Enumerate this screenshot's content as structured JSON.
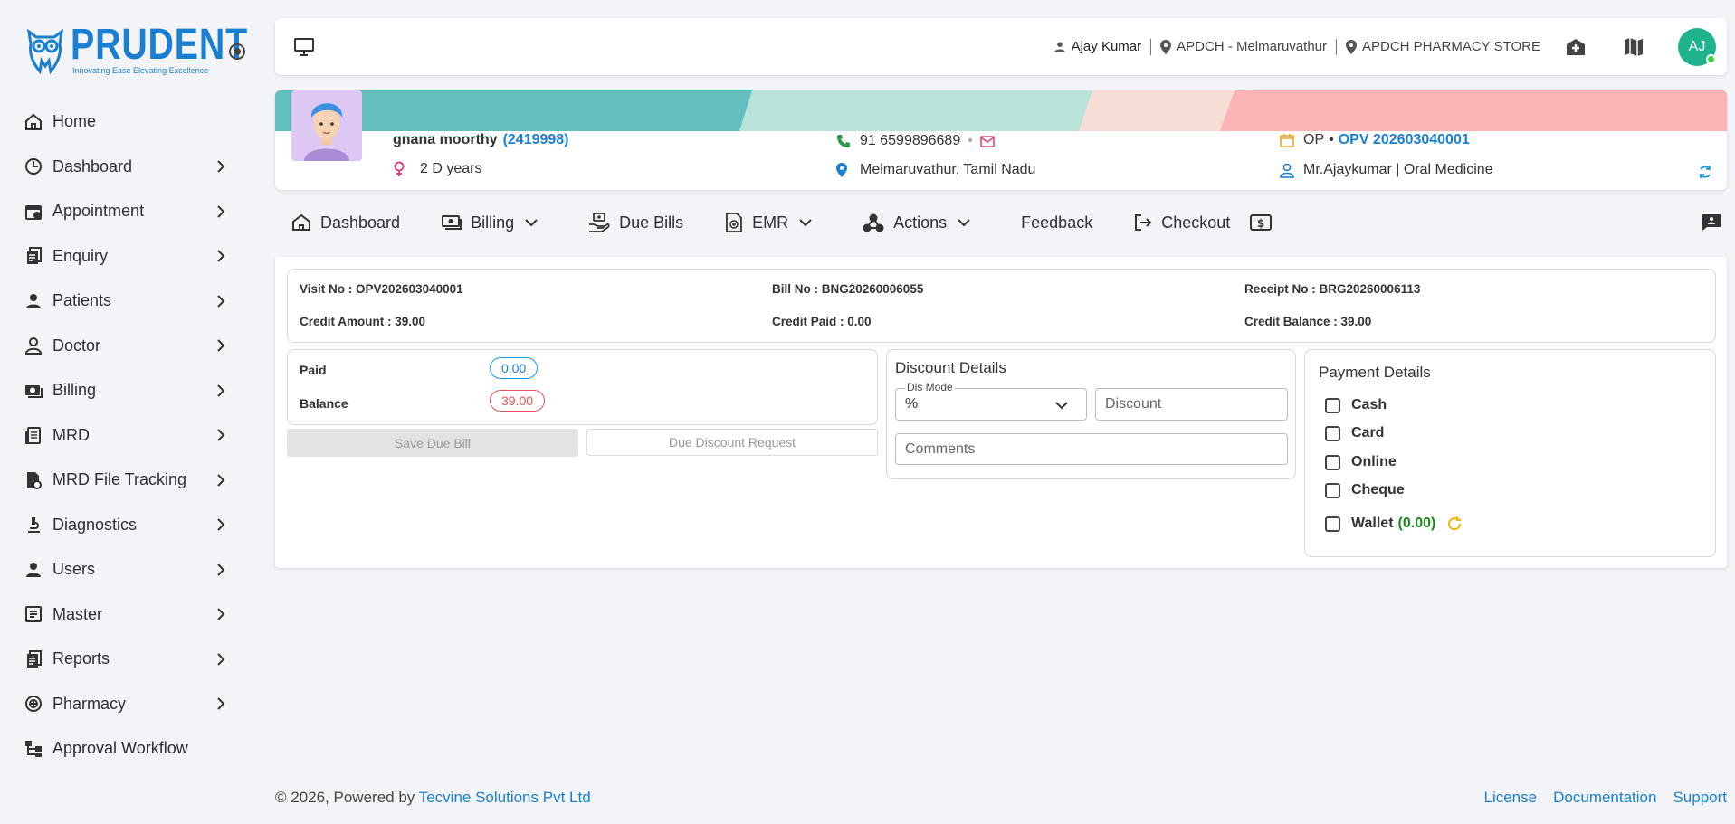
{
  "brand": {
    "name": "PRUDENT",
    "tagline": "Innovating Ease Elevating Excellence"
  },
  "sidebar": {
    "items": [
      {
        "label": "Home",
        "icon": "home-icon"
      },
      {
        "label": "Dashboard",
        "icon": "clock-icon"
      },
      {
        "label": "Appointment",
        "icon": "calendar-icon"
      },
      {
        "label": "Enquiry",
        "icon": "document-icon"
      },
      {
        "label": "Patients",
        "icon": "person-icon"
      },
      {
        "label": "Doctor",
        "icon": "doctor-icon"
      },
      {
        "label": "Billing",
        "icon": "money-icon"
      },
      {
        "label": "MRD",
        "icon": "records-icon"
      },
      {
        "label": "MRD File Tracking",
        "icon": "file-tracking-icon"
      },
      {
        "label": "Diagnostics",
        "icon": "microscope-icon"
      },
      {
        "label": "Users",
        "icon": "person-icon"
      },
      {
        "label": "Master",
        "icon": "list-icon"
      },
      {
        "label": "Reports",
        "icon": "report-icon"
      },
      {
        "label": "Pharmacy",
        "icon": "pharmacy-icon"
      },
      {
        "label": "Approval Workflow",
        "icon": "workflow-icon"
      }
    ]
  },
  "header": {
    "user": "Ajay Kumar",
    "location": "APDCH - Melmaruvathur",
    "store": "APDCH PHARMACY STORE",
    "avatar_initials": "AJ"
  },
  "patient": {
    "name": "gnana moorthy",
    "id": "(2419998)",
    "age": "2 D years",
    "phone": "91 6599896689",
    "address": "Melmaruvathur, Tamil Nadu",
    "visit_type": "OP",
    "visit_no": "OPV 202603040001",
    "doctor": "Mr.Ajaykumar | Oral Medicine"
  },
  "tabs": {
    "dashboard": "Dashboard",
    "billing": "Billing",
    "due_bills": "Due Bills",
    "emr": "EMR",
    "actions": "Actions",
    "feedback": "Feedback",
    "checkout": "Checkout"
  },
  "bill_info": {
    "visit_no": "Visit No : OPV202603040001",
    "bill_no": "Bill No : BNG20260006055",
    "receipt_no": "Receipt No : BRG20260006113",
    "credit_amount": "Credit Amount : 39.00",
    "credit_paid": "Credit Paid : 0.00",
    "credit_balance": "Credit Balance : 39.00"
  },
  "payment_summary": {
    "paid_label": "Paid",
    "paid_value": "0.00",
    "balance_label": "Balance",
    "balance_value": "39.00"
  },
  "buttons": {
    "save_due_bill": "Save Due Bill",
    "due_discount_request": "Due Discount Request"
  },
  "discount": {
    "title": "Discount Details",
    "mode_label": "Dis Mode",
    "mode_value": "%",
    "discount_placeholder": "Discount",
    "comments_placeholder": "Comments"
  },
  "payment_details": {
    "title": "Payment Details",
    "options": [
      "Cash",
      "Card",
      "Online",
      "Cheque"
    ],
    "wallet_label": "Wallet",
    "wallet_amount": "(0.00)"
  },
  "footer": {
    "copyright": "© 2026, Powered by",
    "company": "Tecvine Solutions Pvt Ltd",
    "links": [
      "License",
      "Documentation",
      "Support"
    ]
  },
  "colors": {
    "accent": "#1a7fd1",
    "avatar": "#1eb38d",
    "wallet_green": "#1a8a1a",
    "balance_red": "#e05555"
  }
}
